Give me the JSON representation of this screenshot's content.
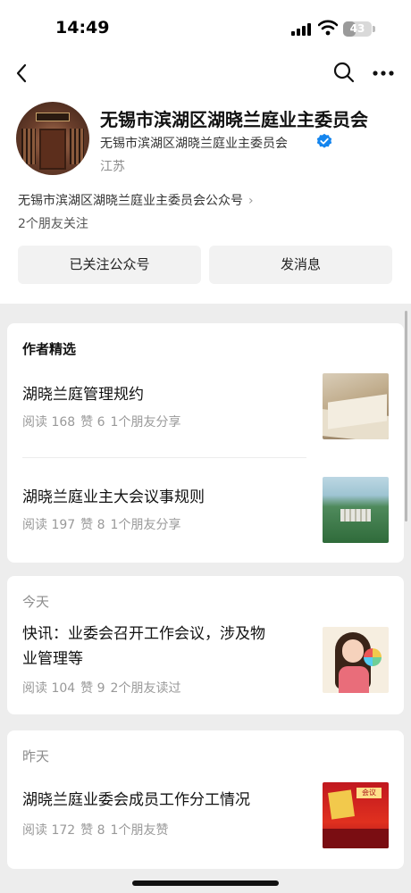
{
  "status": {
    "time": "14:49",
    "battery": "43",
    "battery_level": 0.43
  },
  "account": {
    "name": "无锡市滨湖区湖晓兰庭业主委员会",
    "subject": "无锡市滨湖区湖晓兰庭业主委员会",
    "region": "江苏",
    "official_link": "无锡市滨湖区湖晓兰庭业主委员会公众号",
    "friends_follow": "2个朋友关注",
    "follow_button": "已关注公众号",
    "message_button": "发消息"
  },
  "featured": {
    "title": "作者精选",
    "articles": [
      {
        "title": "湖晓兰庭管理规约",
        "reads": "阅读 168",
        "likes": "赞 6",
        "social": "1个朋友分享",
        "thumb": "book-image"
      },
      {
        "title": "湖晓兰庭业主大会议事规则",
        "reads": "阅读 197",
        "likes": "赞 8",
        "social": "1个朋友分享",
        "thumb": "aerial-image"
      }
    ]
  },
  "today": {
    "date": "今天",
    "article": {
      "title_line1": "快讯：业委会召开工作会议，涉及物",
      "title_line2": "业管理等",
      "reads": "阅读 104",
      "likes": "赞 9",
      "social": "2个朋友读过",
      "thumb": "girl-illustration"
    }
  },
  "yesterday": {
    "date": "昨天",
    "article": {
      "title": "湖晓兰庭业委会成员工作分工情况",
      "reads": "阅读 172",
      "likes": "赞 8",
      "social": "1个朋友赞",
      "thumb": "meeting-image",
      "thumb_sign": "会议"
    }
  },
  "colors": {
    "verified": "#1485ee",
    "feed_bg": "#ededed",
    "meta_gray": "#999999"
  }
}
